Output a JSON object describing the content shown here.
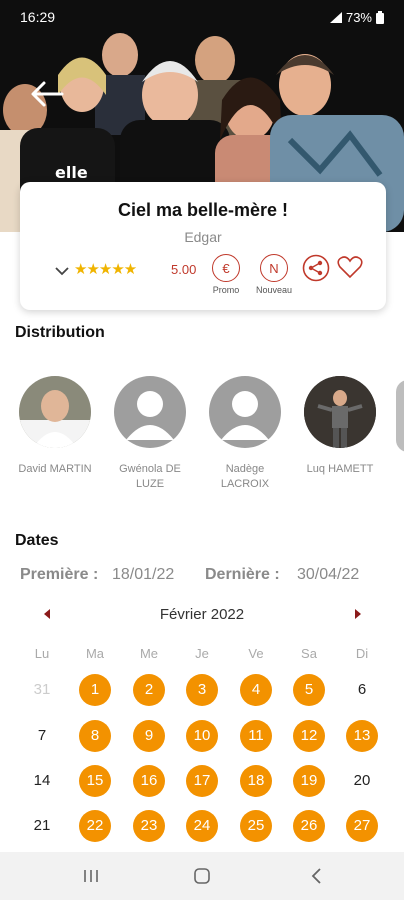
{
  "status": {
    "time": "16:29",
    "battery": "73%"
  },
  "show": {
    "title": "Ciel ma belle-mère !",
    "subtitle": "Edgar",
    "stars": "★★★★★",
    "rating": "5.00",
    "promo_label": "Promo",
    "nouveau_label": "Nouveau",
    "promo_symbol": "€",
    "nouveau_symbol": "N"
  },
  "distribution": {
    "heading": "Distribution",
    "cast": [
      {
        "name": "David MARTIN",
        "photo": "photo"
      },
      {
        "name": "Gwénola DE LUZE",
        "photo": "placeholder"
      },
      {
        "name": "Nadège LACROIX",
        "photo": "placeholder"
      },
      {
        "name": "Luq HAMETT",
        "photo": "photo"
      }
    ]
  },
  "dates": {
    "heading": "Dates",
    "premiere_label": "Première :",
    "premiere_value": "18/01/22",
    "derniere_label": "Dernière :",
    "derniere_value": "30/04/22"
  },
  "calendar": {
    "month": "Février 2022",
    "weekdays": [
      "Lu",
      "Ma",
      "Me",
      "Je",
      "Ve",
      "Sa",
      "Di"
    ],
    "weeks": [
      [
        {
          "d": "31",
          "s": "prev"
        },
        {
          "d": "1",
          "s": "on"
        },
        {
          "d": "2",
          "s": "on"
        },
        {
          "d": "3",
          "s": "on"
        },
        {
          "d": "4",
          "s": "on"
        },
        {
          "d": "5",
          "s": "on"
        },
        {
          "d": "6",
          "s": "off"
        }
      ],
      [
        {
          "d": "7",
          "s": "off"
        },
        {
          "d": "8",
          "s": "on"
        },
        {
          "d": "9",
          "s": "on"
        },
        {
          "d": "10",
          "s": "on"
        },
        {
          "d": "11",
          "s": "on"
        },
        {
          "d": "12",
          "s": "on"
        },
        {
          "d": "13",
          "s": "on"
        }
      ],
      [
        {
          "d": "14",
          "s": "off"
        },
        {
          "d": "15",
          "s": "on"
        },
        {
          "d": "16",
          "s": "on"
        },
        {
          "d": "17",
          "s": "on"
        },
        {
          "d": "18",
          "s": "on"
        },
        {
          "d": "19",
          "s": "on"
        },
        {
          "d": "20",
          "s": "off"
        }
      ],
      [
        {
          "d": "21",
          "s": "off"
        },
        {
          "d": "22",
          "s": "on"
        },
        {
          "d": "23",
          "s": "on"
        },
        {
          "d": "24",
          "s": "on"
        },
        {
          "d": "25",
          "s": "on"
        },
        {
          "d": "26",
          "s": "on"
        },
        {
          "d": "27",
          "s": "on"
        }
      ]
    ]
  },
  "colors": {
    "accent": "#f39200",
    "brand_red": "#c0392b",
    "star": "#f0b400"
  },
  "icons": [
    "back-arrow-icon",
    "chevron-down-icon",
    "euro-icon",
    "new-icon",
    "share-icon",
    "heart-icon",
    "prev-month-icon",
    "next-month-icon",
    "recents-icon",
    "home-icon",
    "back-icon"
  ]
}
